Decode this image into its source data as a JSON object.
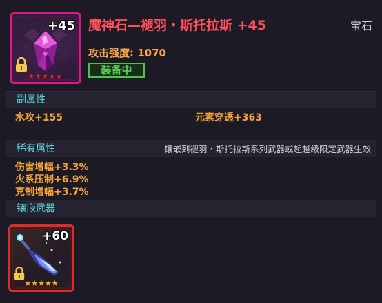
{
  "item": {
    "title": "魔神石—褪羽・斯托拉斯 +45",
    "category": "宝石",
    "level_label": "+45",
    "attack_label": "攻击强度: 1070",
    "equip_badge": "装备中",
    "rarity_color": "#d81b8a",
    "stars": "★★★★★"
  },
  "secondary": {
    "header": "副属性",
    "left": "水攻+155",
    "right": "元素穿透+363"
  },
  "rare": {
    "header": "稀有属性",
    "note": "镶嵌到褪羽・斯托拉斯系列武器或超越级限定武器生效",
    "attrs": [
      "伤害增幅+3.3%",
      "火系压制+6.9%",
      "克制增幅+3.7%"
    ]
  },
  "socket": {
    "header": "镶嵌武器",
    "weapon_level": "+60",
    "weapon_stars": "★★★★★",
    "weapon_border_color": "#e02a2a"
  },
  "icons": {
    "gem": "purple-gem-icon",
    "lock": "lock-icon",
    "weapon": "blade-weapon-icon"
  }
}
